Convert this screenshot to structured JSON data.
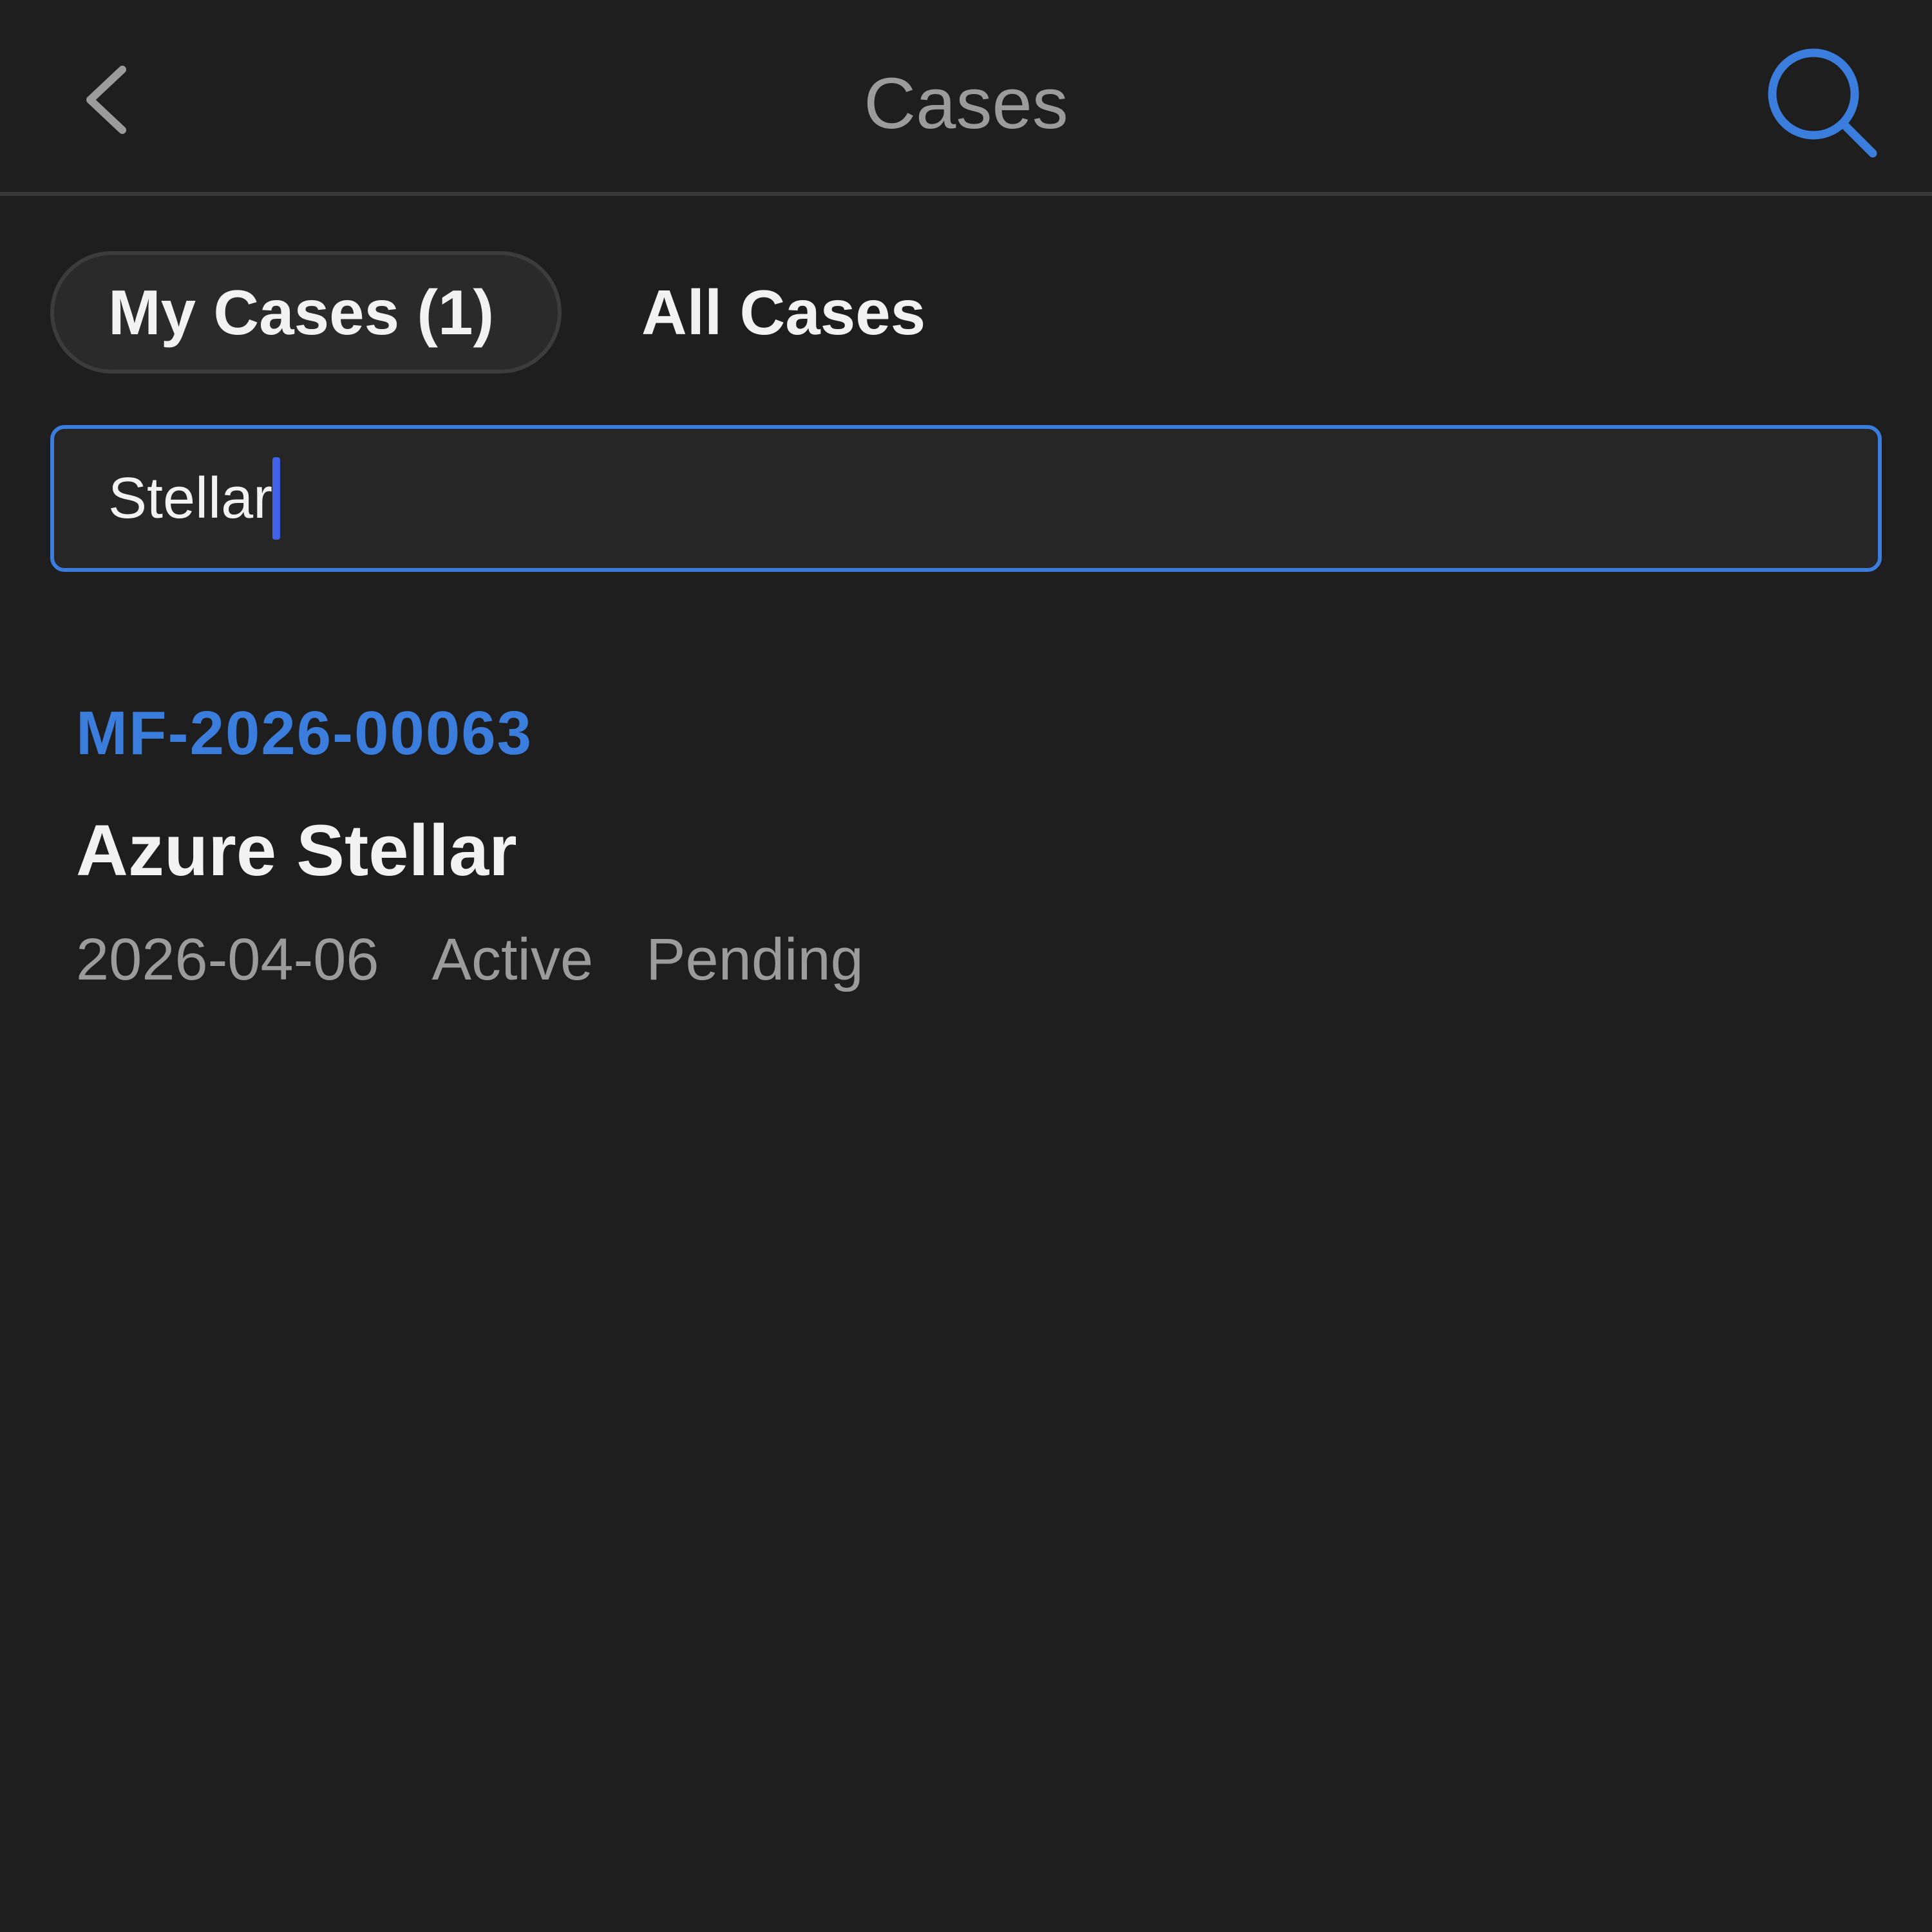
{
  "header": {
    "title": "Cases",
    "back_icon": "chevron-left-icon",
    "search_icon": "search-icon"
  },
  "tabs": [
    {
      "label": "My Cases (1)",
      "selected": true
    },
    {
      "label": "All Cases",
      "selected": false
    }
  ],
  "search": {
    "value": "Stellar"
  },
  "results": [
    {
      "case_id": "MF-2026-00063",
      "name": "Azure Stellar",
      "date": "2026-04-06",
      "status": "Active",
      "stage": "Pending"
    }
  ],
  "colors": {
    "background": "#1e1e1e",
    "accent": "#3b7ddd",
    "text_primary": "#f2f2f2",
    "text_secondary": "#9b9b9b",
    "caret": "#3f62e6"
  }
}
